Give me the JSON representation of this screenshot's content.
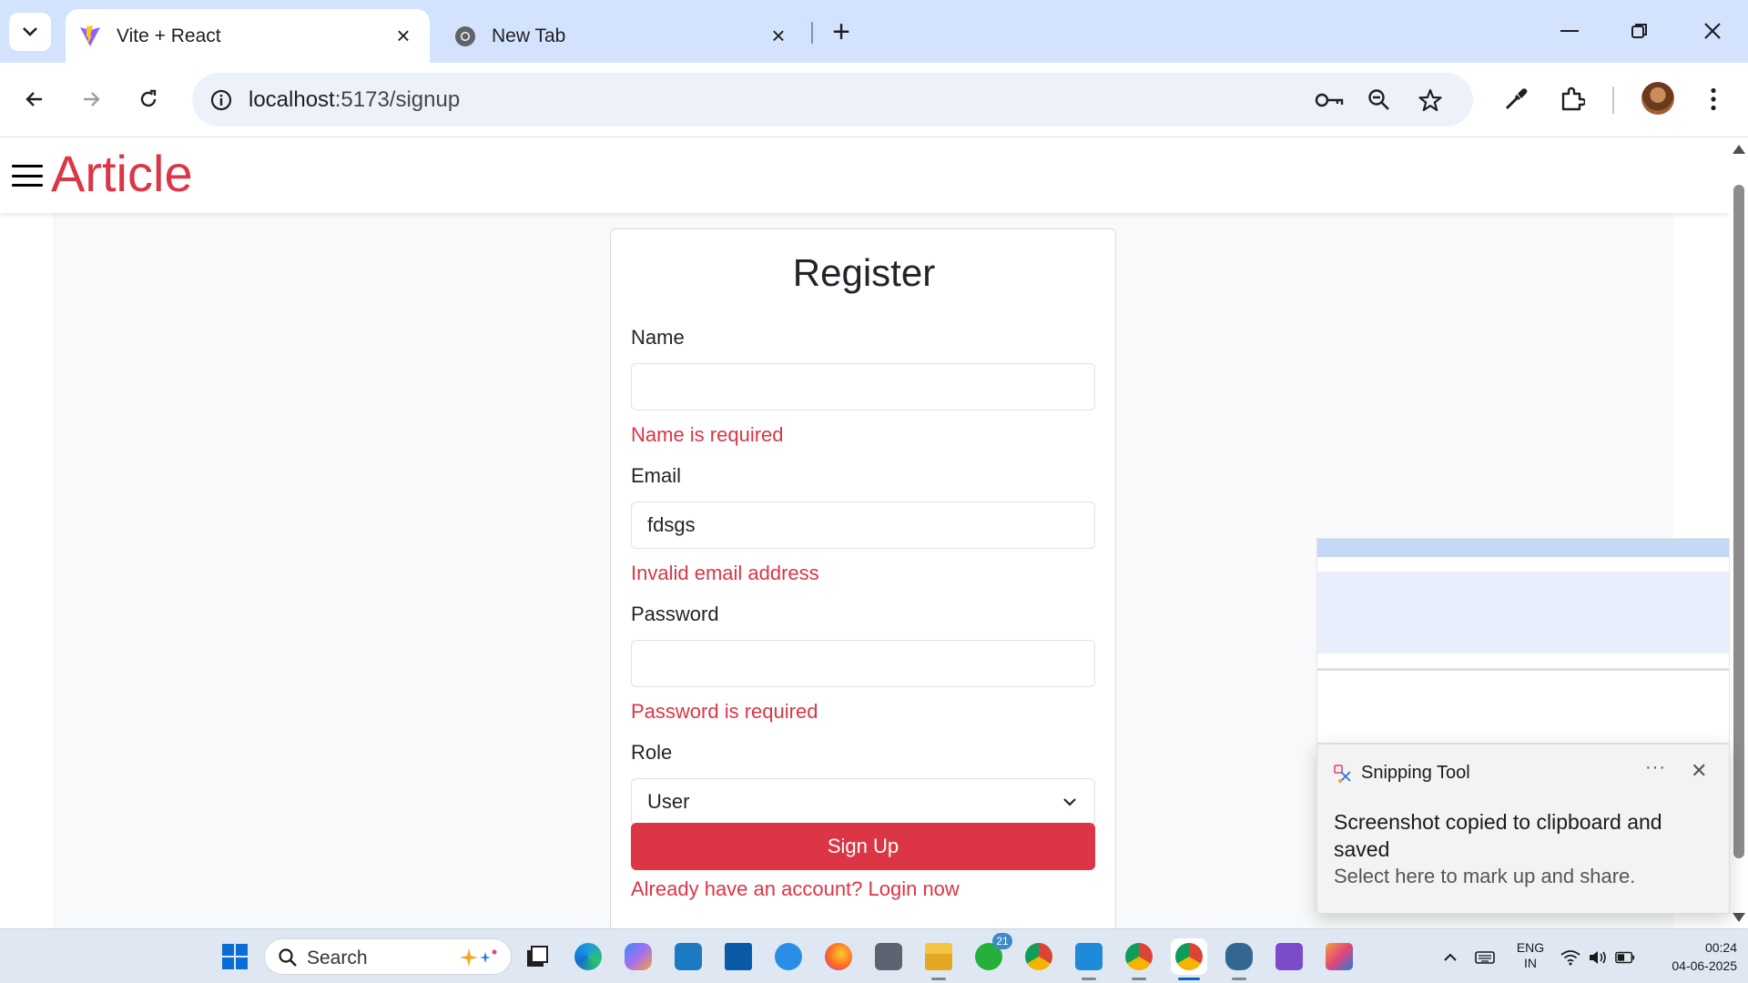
{
  "browser": {
    "tabs": [
      {
        "title": "Vite + React",
        "active": true,
        "favicon": "vite-icon"
      },
      {
        "title": "New Tab",
        "active": false,
        "favicon": "chrome-icon"
      }
    ],
    "address": {
      "host": "localhost",
      "path": ":5173/signup"
    }
  },
  "app": {
    "brand": "Article"
  },
  "form": {
    "title": "Register",
    "name_label": "Name",
    "name_value": "",
    "name_error": "Name is required",
    "email_label": "Email",
    "email_value": "fdsgs",
    "email_error": "Invalid email address",
    "password_label": "Password",
    "password_value": "",
    "password_error": "Password is required",
    "role_label": "Role",
    "role_value": "User",
    "submit_label": "Sign Up",
    "login_prompt": "Already have an account? Login now"
  },
  "toast": {
    "app_name": "Snipping Tool",
    "more": "···",
    "message": "Screenshot copied to clipboard and saved",
    "sub": "Select here to mark up and share."
  },
  "taskbar": {
    "search_label": "Search",
    "whatsapp_badge": "21",
    "lang_top": "ENG",
    "lang_bottom": "IN",
    "time": "00:24",
    "date": "04-06-2025"
  },
  "colors": {
    "accent_red": "#dc3545",
    "chrome_frame": "#d3e3fd",
    "omnibox_bg": "#edf2fa"
  }
}
